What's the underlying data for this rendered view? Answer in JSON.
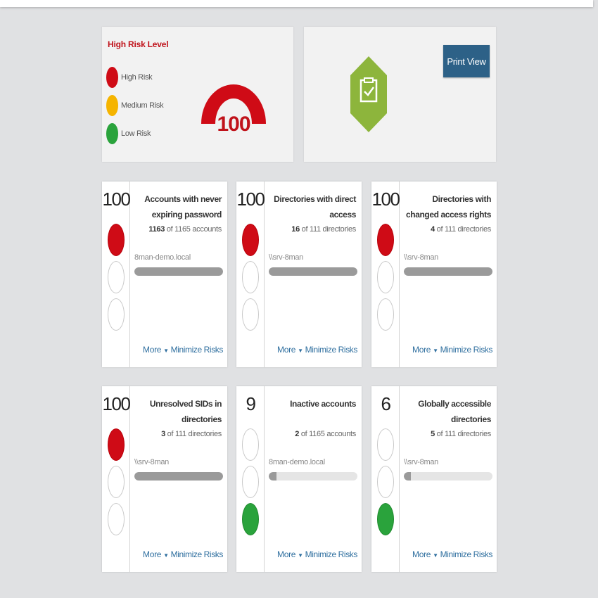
{
  "legend": {
    "title": "High Risk Level",
    "items": [
      {
        "label": "High Risk",
        "color": "#cf0b16"
      },
      {
        "label": "Medium Risk",
        "color": "#f5b400"
      },
      {
        "label": "Low Risk",
        "color": "#2aa33c"
      }
    ]
  },
  "gauge": {
    "value": "100",
    "level": 1.0,
    "color": "#cf0b16"
  },
  "print_view": {
    "label": "Print View"
  },
  "report_icon": {
    "icon": "clipboard-check-icon",
    "color": "#8db53c"
  },
  "cards": [
    {
      "score": "100",
      "title": "Accounts with never expiring password",
      "count": "1163",
      "count_text": " of 1165 accounts",
      "domain": "8man-demo.local",
      "progress": 0.998,
      "level": "high",
      "more": "More",
      "minimize": "Minimize Risks"
    },
    {
      "score": "100",
      "title": "Directories with direct access",
      "count": "16",
      "count_text": " of 111 directories",
      "domain": "\\\\srv-8man",
      "progress": 1.0,
      "level": "high",
      "more": "More",
      "minimize": "Minimize Risks"
    },
    {
      "score": "100",
      "title": "Directories with changed access rights",
      "count": "4",
      "count_text": " of 111 directories",
      "domain": "\\\\srv-8man",
      "progress": 1.0,
      "level": "high",
      "more": "More",
      "minimize": "Minimize Risks"
    },
    {
      "score": "100",
      "title": "Unresolved SIDs in directories",
      "count": "3",
      "count_text": " of 111 directories",
      "domain": "\\\\srv-8man",
      "progress": 1.0,
      "level": "high",
      "more": "More",
      "minimize": "Minimize Risks"
    },
    {
      "score": "9",
      "title": "Inactive accounts",
      "count": "2",
      "count_text": " of 1165 accounts",
      "domain": "8man-demo.local",
      "progress": 0.09,
      "level": "low",
      "more": "More",
      "minimize": "Minimize Risks"
    },
    {
      "score": "6",
      "title": "Globally accessible directories",
      "count": "5",
      "count_text": " of 111 directories",
      "domain": "\\\\srv-8man",
      "progress": 0.06,
      "level": "low",
      "more": "More",
      "minimize": "Minimize Risks"
    }
  ]
}
